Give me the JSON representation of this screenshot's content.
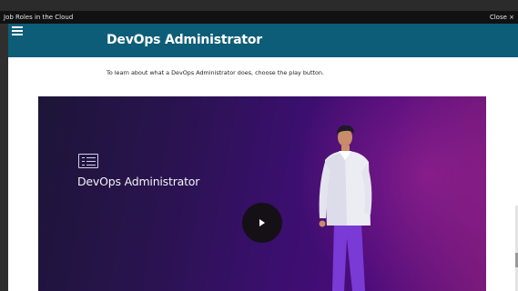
{
  "window": {
    "title": "Job Roles in the Cloud",
    "close_label": "Close ×"
  },
  "header": {
    "title": "DevOps Administrator",
    "menu_icon": "hamburger-menu-icon",
    "background": "#0d5d78"
  },
  "instruction": "To learn about what a DevOps Administrator does, choose the play button.",
  "video": {
    "title": "DevOps Administrator",
    "play_icon": "play-icon",
    "document_icon": "document-list-icon",
    "illustration": "person-illustration"
  },
  "colors": {
    "accent": "#0d5d78",
    "video_dark": "#1d1538",
    "video_purple": "#4a0b7a",
    "video_magenta": "#7a1a7a"
  }
}
